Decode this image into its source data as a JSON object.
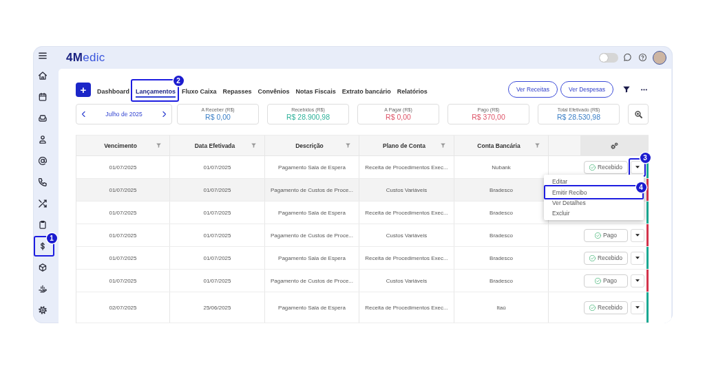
{
  "logo": "**4M**edic",
  "topbar": {
    "theme_toggle": {
      "on": false
    }
  },
  "sidebar": {
    "items": [
      {
        "highlighted": false
      },
      {
        "highlighted": false
      },
      {
        "highlighted": false
      },
      {
        "highlighted": false
      },
      {
        "highlighted": false
      },
      {
        "highlighted": false
      },
      {
        "highlighted": false
      },
      {
        "highlighted": false
      },
      {
        "highlighted": true,
        "callout": "1"
      },
      {
        "highlighted": false
      },
      {
        "highlighted": false
      },
      {
        "highlighted": false
      }
    ]
  },
  "add_button": "+",
  "tabs": [
    {
      "label": "Dashboard",
      "selected": false,
      "highlighted": false
    },
    {
      "label": "Lançamentos",
      "selected": true,
      "highlighted": true,
      "callout": "2"
    },
    {
      "label": "Fluxo Caixa",
      "selected": false,
      "highlighted": false
    },
    {
      "label": "Repasses",
      "selected": false,
      "highlighted": false
    },
    {
      "label": "Convênios",
      "selected": false,
      "highlighted": false
    },
    {
      "label": "Notas Fiscais",
      "selected": false,
      "highlighted": false
    },
    {
      "label": "Extrato bancário",
      "selected": false,
      "highlighted": false
    },
    {
      "label": "Relatórios",
      "selected": false,
      "highlighted": false
    }
  ],
  "view_buttons": [
    "Ver Receitas",
    "Ver Despesas"
  ],
  "period": "Julho de 2025",
  "summary": [
    {
      "label": "A Receber (R$)",
      "value": "R$ 0,00",
      "color": "#3b7fc6"
    },
    {
      "label": "Recebidos (R$)",
      "value": "R$ 28.900,98",
      "color": "#2fb29a"
    },
    {
      "label": "A Pagar (R$)",
      "value": "R$ 0,00",
      "color": "#de5468"
    },
    {
      "label": "Pago (R$)",
      "value": "R$ 370,00",
      "color": "#de5468"
    },
    {
      "label": "Total Efetivado (R$)",
      "value": "R$ 28.530,98",
      "color": "#3b7fc6"
    }
  ],
  "table": {
    "columns": [
      "Vencimento",
      "Data Efetivada",
      "Descrição",
      "Plano de Conta",
      "Conta Bancária"
    ],
    "rows": [
      {
        "cells": [
          "01/07/2025",
          "01/07/2025",
          "Pagamento Sala de Espera",
          "Receita de Procedimentos Exec...",
          "Nubank"
        ],
        "status": "Recebido",
        "color": "#1aa892",
        "hovered": false,
        "menu_button": {
          "highlighted": true,
          "callout": "3"
        },
        "menu": [
          {
            "label": "Editar",
            "highlighted": false
          },
          {
            "label": "Emitir Recibo",
            "highlighted": true,
            "callout": "4"
          },
          {
            "label": "Ver Detalhes",
            "highlighted": false
          },
          {
            "label": "Excluir",
            "highlighted": false
          }
        ]
      },
      {
        "cells": [
          "01/07/2025",
          "01/07/2025",
          "Pagamento de Custos de Proce...",
          "Custos Variáveis",
          "Bradesco"
        ],
        "color": "#d3344c",
        "hovered": true
      },
      {
        "cells": [
          "01/07/2025",
          "01/07/2025",
          "Pagamento Sala de Espera",
          "Receita de Procedimentos Exec...",
          "Bradesco"
        ],
        "color": "#1aa892",
        "hovered": false
      },
      {
        "cells": [
          "01/07/2025",
          "01/07/2025",
          "Pagamento de Custos de Proce...",
          "Custos Variáveis",
          "Bradesco"
        ],
        "status": "Pago",
        "color": "#d3344c",
        "hovered": false,
        "menu_button": {
          "highlighted": false
        }
      },
      {
        "cells": [
          "01/07/2025",
          "01/07/2025",
          "Pagamento Sala de Espera",
          "Receita de Procedimentos Exec...",
          "Bradesco"
        ],
        "status": "Recebido",
        "color": "#1aa892",
        "hovered": false,
        "menu_button": {
          "highlighted": false
        }
      },
      {
        "cells": [
          "01/07/2025",
          "01/07/2025",
          "Pagamento de Custos de Proce...",
          "Custos Variáveis",
          "Bradesco"
        ],
        "status": "Pago",
        "color": "#d3344c",
        "hovered": false,
        "menu_button": {
          "highlighted": false
        }
      },
      {
        "cells": [
          "02/07/2025",
          "25/06/2025",
          "Pagamento Sala de Espera",
          "Receita de Procedimentos Exec...",
          "Itaú"
        ],
        "status": "Recebido",
        "color": "#1aa892",
        "hovered": false,
        "menu_button": {
          "highlighted": false
        }
      }
    ]
  }
}
